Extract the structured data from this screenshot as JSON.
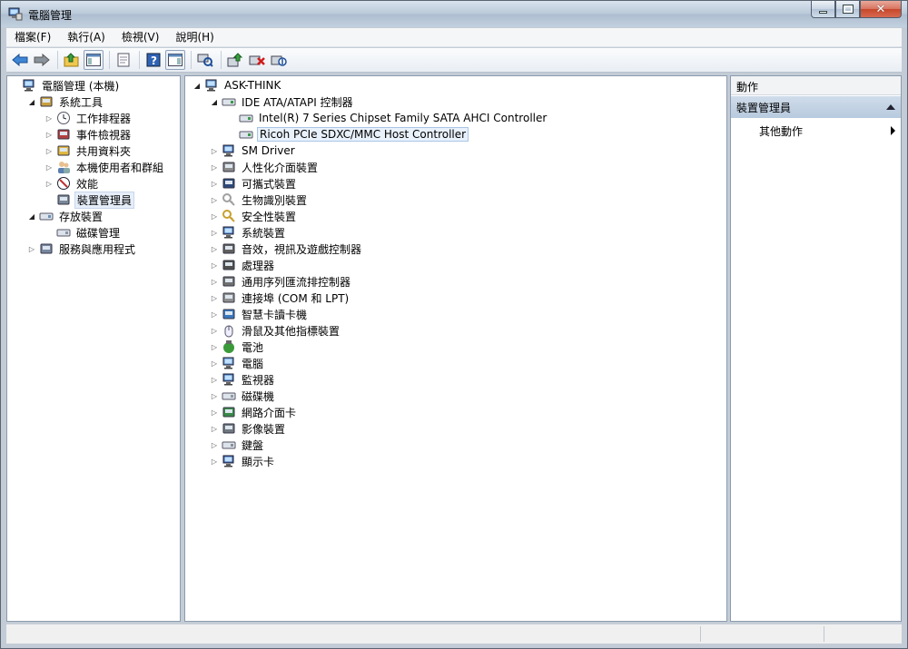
{
  "window": {
    "title": "電腦管理"
  },
  "menu": [
    {
      "label": "檔案(F)"
    },
    {
      "label": "執行(A)"
    },
    {
      "label": "檢視(V)"
    },
    {
      "label": "說明(H)"
    }
  ],
  "toolbar": {
    "buttons": [
      "back-icon",
      "forward-icon",
      "up-folder-icon",
      "show-hide-console-tree-icon",
      "export-list-icon",
      "help-icon",
      "show-hide-action-pane-icon",
      "scan-hardware-icon",
      "update-driver-icon",
      "uninstall-device-icon",
      "disable-device-icon"
    ]
  },
  "left_tree": [
    {
      "label": "電腦管理 (本機)",
      "depth": 0,
      "arrow": "",
      "icon": "computer-management-icon"
    },
    {
      "label": "系統工具",
      "depth": 1,
      "arrow": "open",
      "icon": "system-tools-icon"
    },
    {
      "label": "工作排程器",
      "depth": 2,
      "arrow": "closed",
      "icon": "clock-icon"
    },
    {
      "label": "事件檢視器",
      "depth": 2,
      "arrow": "closed",
      "icon": "event-viewer-icon"
    },
    {
      "label": "共用資料夾",
      "depth": 2,
      "arrow": "closed",
      "icon": "shared-folder-icon"
    },
    {
      "label": "本機使用者和群組",
      "depth": 2,
      "arrow": "closed",
      "icon": "users-icon"
    },
    {
      "label": "效能",
      "depth": 2,
      "arrow": "closed",
      "icon": "performance-icon"
    },
    {
      "label": "裝置管理員",
      "depth": 2,
      "arrow": "",
      "icon": "device-manager-icon",
      "selected": true
    },
    {
      "label": "存放裝置",
      "depth": 1,
      "arrow": "open",
      "icon": "storage-icon"
    },
    {
      "label": "磁碟管理",
      "depth": 2,
      "arrow": "",
      "icon": "disk-management-icon"
    },
    {
      "label": "服務與應用程式",
      "depth": 1,
      "arrow": "closed",
      "icon": "services-icon"
    }
  ],
  "device_tree": [
    {
      "label": "ASK-THINK",
      "depth": 0,
      "arrow": "open",
      "icon": "computer-icon"
    },
    {
      "label": "IDE ATA/ATAPI 控制器",
      "depth": 1,
      "arrow": "open",
      "icon": "ide-controller-icon"
    },
    {
      "label": "Intel(R) 7 Series Chipset Family SATA AHCI Controller",
      "depth": 2,
      "arrow": "",
      "icon": "ide-controller-icon"
    },
    {
      "label": "Ricoh PCIe SDXC/MMC Host Controller",
      "depth": 2,
      "arrow": "",
      "icon": "ide-controller-icon",
      "selected": true
    },
    {
      "label": "SM Driver",
      "depth": 1,
      "arrow": "closed",
      "icon": "monitor-icon"
    },
    {
      "label": "人性化介面裝置",
      "depth": 1,
      "arrow": "closed",
      "icon": "hid-icon"
    },
    {
      "label": "可攜式裝置",
      "depth": 1,
      "arrow": "closed",
      "icon": "portable-device-icon"
    },
    {
      "label": "生物識別裝置",
      "depth": 1,
      "arrow": "closed",
      "icon": "biometric-icon"
    },
    {
      "label": "安全性裝置",
      "depth": 1,
      "arrow": "closed",
      "icon": "key-icon"
    },
    {
      "label": "系統裝置",
      "depth": 1,
      "arrow": "closed",
      "icon": "system-device-icon"
    },
    {
      "label": "音效，視訊及遊戲控制器",
      "depth": 1,
      "arrow": "closed",
      "icon": "speaker-icon"
    },
    {
      "label": "處理器",
      "depth": 1,
      "arrow": "closed",
      "icon": "processor-icon"
    },
    {
      "label": "通用序列匯流排控制器",
      "depth": 1,
      "arrow": "closed",
      "icon": "usb-icon"
    },
    {
      "label": "連接埠 (COM 和 LPT)",
      "depth": 1,
      "arrow": "closed",
      "icon": "port-icon"
    },
    {
      "label": "智慧卡讀卡機",
      "depth": 1,
      "arrow": "closed",
      "icon": "smartcard-icon"
    },
    {
      "label": "滑鼠及其他指標裝置",
      "depth": 1,
      "arrow": "closed",
      "icon": "mouse-icon"
    },
    {
      "label": "電池",
      "depth": 1,
      "arrow": "closed",
      "icon": "battery-icon"
    },
    {
      "label": "電腦",
      "depth": 1,
      "arrow": "closed",
      "icon": "computer-icon"
    },
    {
      "label": "監視器",
      "depth": 1,
      "arrow": "closed",
      "icon": "monitor-icon"
    },
    {
      "label": "磁碟機",
      "depth": 1,
      "arrow": "closed",
      "icon": "disk-drive-icon"
    },
    {
      "label": "網路介面卡",
      "depth": 1,
      "arrow": "closed",
      "icon": "network-adapter-icon"
    },
    {
      "label": "影像裝置",
      "depth": 1,
      "arrow": "closed",
      "icon": "camera-icon"
    },
    {
      "label": "鍵盤",
      "depth": 1,
      "arrow": "closed",
      "icon": "keyboard-icon"
    },
    {
      "label": "顯示卡",
      "depth": 1,
      "arrow": "closed",
      "icon": "display-adapter-icon"
    }
  ],
  "actions": {
    "header": "動作",
    "section": "裝置管理員",
    "item": "其他動作"
  }
}
